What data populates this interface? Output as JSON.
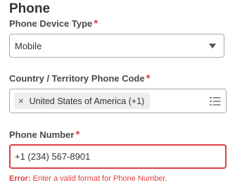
{
  "section": {
    "title": "Phone"
  },
  "device_type": {
    "label": "Phone Device Type",
    "required_marker": "*",
    "value": "Mobile",
    "icon": "chevron-down-icon"
  },
  "country_code": {
    "label": "Country / Territory Phone Code",
    "required_marker": "*",
    "selected": [
      {
        "label": "United States of America (+1)",
        "remove_symbol": "×"
      }
    ],
    "icon": "list-icon"
  },
  "phone_number": {
    "label": "Phone Number",
    "required_marker": "*",
    "value": "+1 (234) 567-8901",
    "error_prefix": "Error:",
    "error_text": "Enter a valid format for Phone Number."
  },
  "colors": {
    "error": "#de4040",
    "border": "#aaaaaa",
    "pill_background": "#eeeeee"
  }
}
